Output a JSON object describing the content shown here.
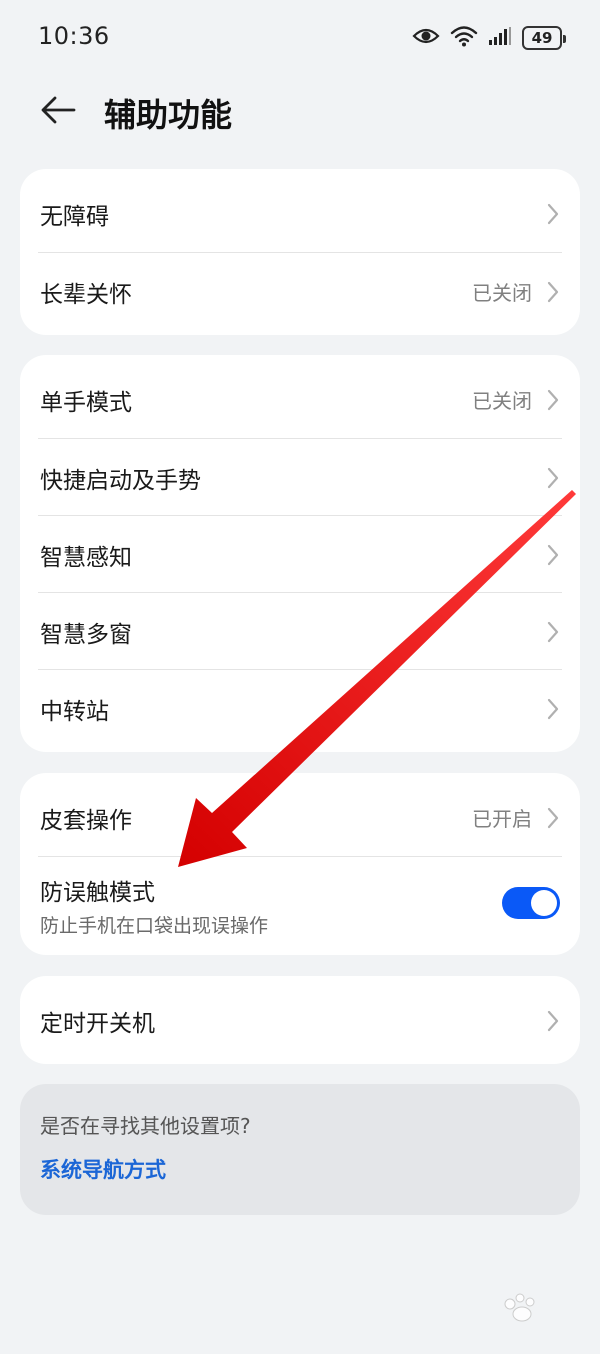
{
  "status_bar": {
    "time": "10:36",
    "battery": "49",
    "icons": [
      "eye-icon",
      "wifi-icon",
      "signal-icon",
      "battery-icon"
    ]
  },
  "header": {
    "title": "辅助功能",
    "back_icon": "back-arrow-icon"
  },
  "group1": {
    "items": [
      {
        "label": "无障碍",
        "value": ""
      },
      {
        "label": "长辈关怀",
        "value": "已关闭"
      }
    ]
  },
  "group2": {
    "items": [
      {
        "label": "单手模式",
        "value": "已关闭"
      },
      {
        "label": "快捷启动及手势",
        "value": ""
      },
      {
        "label": "智慧感知",
        "value": ""
      },
      {
        "label": "智慧多窗",
        "value": ""
      },
      {
        "label": "中转站",
        "value": ""
      }
    ]
  },
  "group3": {
    "items": [
      {
        "label": "皮套操作",
        "value": "已开启"
      },
      {
        "label": "防误触模式",
        "sublabel": "防止手机在口袋出现误操作",
        "toggle_on": true
      }
    ]
  },
  "group4": {
    "items": [
      {
        "label": "定时开关机",
        "value": ""
      }
    ]
  },
  "suggestion": {
    "question": "是否在寻找其他设置项?",
    "link": "系统导航方式"
  },
  "colors": {
    "background": "#f1f3f5",
    "card": "#ffffff",
    "accent": "#0a59f7",
    "link": "#1b66d6",
    "annotation_arrow": "#e01010"
  }
}
